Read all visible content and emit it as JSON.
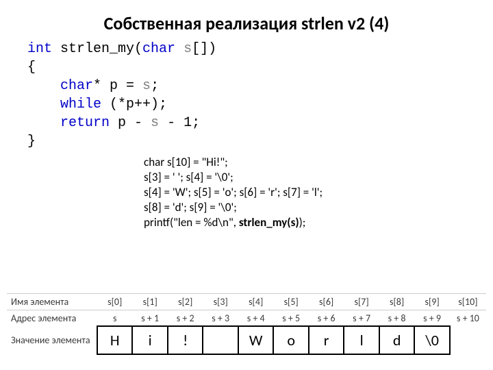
{
  "title": "Собственная реализация strlen v2 (4)",
  "code": {
    "l1a": "int",
    "l1b": " strlen_my(",
    "l1c": "char",
    "l1d": " s",
    "l1e": "[])",
    "l2": "{",
    "l3a": "    ",
    "l3b": "char",
    "l3c": "* p = ",
    "l3d": "s",
    "l3e": ";",
    "l4a": "    ",
    "l4b": "while",
    "l4c": " (*p++);",
    "l5a": "    ",
    "l5b": "return",
    "l5c": " p - ",
    "l5d": "s",
    "l5e": " - 1;",
    "l6": "}"
  },
  "usage": {
    "u1": "char s[10] = \"Hi!\";",
    "u2": "s[3] = ' '; s[4] = '\\0';",
    "u3": "s[4] = 'W'; s[5] = 'o'; s[6] = 'r'; s[7] = 'l';",
    "u4": "s[8] = 'd'; s[9] = '\\0';",
    "u5a": "printf(\"len = %d\\n\", ",
    "u5b": "strlen_my(s)",
    "u5c": ");"
  },
  "table": {
    "row_name": "Имя элемента",
    "row_addr": "Адрес элемента",
    "row_val": "Значение элемента",
    "names": [
      "s[0]",
      "s[1]",
      "s[2]",
      "s[3]",
      "s[4]",
      "s[5]",
      "s[6]",
      "s[7]",
      "s[8]",
      "s[9]",
      "s[10]"
    ],
    "addrs": [
      "s",
      "s + 1",
      "s + 2",
      "s + 3",
      "s + 4",
      "s + 5",
      "s + 6",
      "s + 7",
      "s + 8",
      "s + 9",
      "s + 10"
    ],
    "values": [
      "H",
      "i",
      "!",
      "",
      "W",
      "o",
      "r",
      "l",
      "d",
      "\\0",
      ""
    ]
  }
}
